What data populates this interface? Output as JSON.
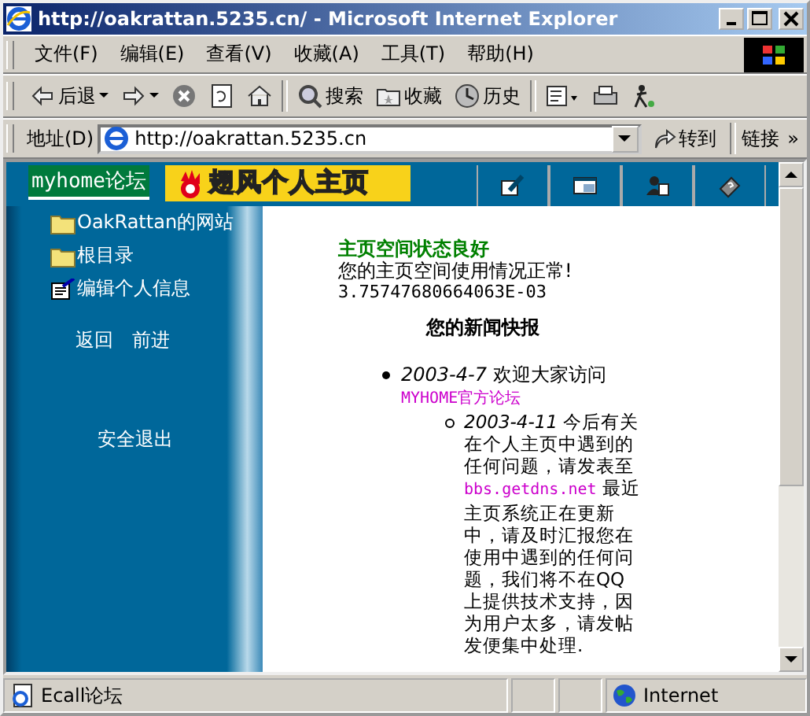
{
  "window": {
    "title": "http://oakrattan.5235.cn/ - Microsoft Internet Explorer"
  },
  "menu": [
    "文件(F)",
    "编辑(E)",
    "查看(V)",
    "收藏(A)",
    "工具(T)",
    "帮助(H)"
  ],
  "toolbar": [
    {
      "kind": "back",
      "label": "后退"
    },
    {
      "kind": "forward"
    },
    {
      "kind": "stop"
    },
    {
      "kind": "refresh"
    },
    {
      "kind": "home"
    },
    {
      "kind": "search",
      "label": "搜索"
    },
    {
      "kind": "favorites",
      "label": "收藏"
    },
    {
      "kind": "history",
      "label": "历史"
    },
    {
      "kind": "mail"
    },
    {
      "kind": "print"
    },
    {
      "kind": "messenger"
    }
  ],
  "address": {
    "label": "地址(D)",
    "value": "http://oakrattan.5235.cn",
    "go": "转到",
    "links": "链接",
    "chevron": "»"
  },
  "page": {
    "forum_label": "myhome论坛",
    "banner": "翅风个人主页",
    "sidebar_items": [
      {
        "kind": "folder",
        "label": "OakRattan的网站"
      },
      {
        "kind": "folder",
        "label": "根目录"
      },
      {
        "kind": "edit",
        "label": "编辑个人信息"
      }
    ],
    "nav": [
      "返回",
      "前进"
    ],
    "logout": "安全退出",
    "status_title": "主页空间状态良好",
    "status_text": "您的主页空间使用情况正常!",
    "usage": "3.75747680664063E-03",
    "news_title": "您的新闻快报",
    "news": [
      {
        "date": "2003-4-7",
        "text": "欢迎大家访问",
        "link": "MYHOME官方论坛",
        "children": [
          {
            "date": "2003-4-11",
            "text": "今后有关在个人主页中遇到的任何问题，请发表至",
            "link": "bbs.getdns.net",
            "after": "最近主页系统正在更新中，请及时汇报您在使用中遇到的任何问题，我们将不在QQ上提供技术支持，因为用户太多，请发帖发便集中处理."
          }
        ]
      }
    ]
  },
  "status_bar": {
    "text": "Ecall论坛",
    "zone": "Internet"
  }
}
